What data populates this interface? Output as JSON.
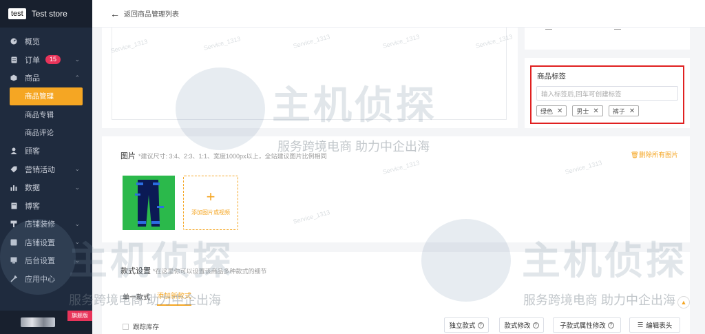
{
  "sidebar": {
    "logo": "test",
    "store_name": "Test store",
    "items": [
      {
        "label": "概览",
        "icon": "dashboard-icon"
      },
      {
        "label": "订单",
        "icon": "order-icon",
        "badge": "15"
      },
      {
        "label": "商品",
        "icon": "product-icon"
      },
      {
        "label": "顾客",
        "icon": "customer-icon"
      },
      {
        "label": "营销活动",
        "icon": "marketing-icon"
      },
      {
        "label": "数据",
        "icon": "chart-icon"
      },
      {
        "label": "博客",
        "icon": "blog-icon"
      },
      {
        "label": "店铺装修",
        "icon": "decorate-icon"
      },
      {
        "label": "店铺设置",
        "icon": "store-settings-icon"
      },
      {
        "label": "后台设置",
        "icon": "admin-settings-icon"
      },
      {
        "label": "应用中心",
        "icon": "apps-icon"
      }
    ],
    "sub_items": [
      "商品管理",
      "商品专辑",
      "商品评论"
    ],
    "plan_badge": "旗舰版"
  },
  "topbar": {
    "back_label": "返回商品管理列表"
  },
  "tags": {
    "title": "商品标签",
    "placeholder": "输入标签后,回车可创建标签",
    "items": [
      "绿色",
      "男士",
      "裤子"
    ]
  },
  "images": {
    "title": "图片",
    "hint": "*建议尺寸: 3:4、2:3、1:1、宽度1000px以上，全站建议图片比例相同",
    "delete_all": "删除所有图片",
    "upload_label": "添加图片或视频"
  },
  "styles": {
    "title": "款式设置",
    "hint": "*在这里你可以设置该商品多种款式的细节",
    "tab_first": "单一款式",
    "tab_add": "添加新款式",
    "track_stock": "跟踪库存",
    "btn_independent": "独立款式",
    "btn_modify": "款式修改",
    "btn_sub_modify": "子款式属性修改",
    "btn_edit_header": "编辑表头"
  },
  "watermark": {
    "brand": "主机侦探",
    "slogan": "服务跨境电商 助力中企出海",
    "small": "Service_1313"
  },
  "colors": {
    "accent": "#f5a623",
    "sidebar_bg": "#1f2b3e",
    "highlight": "#e02020",
    "badge": "#e8345a"
  }
}
